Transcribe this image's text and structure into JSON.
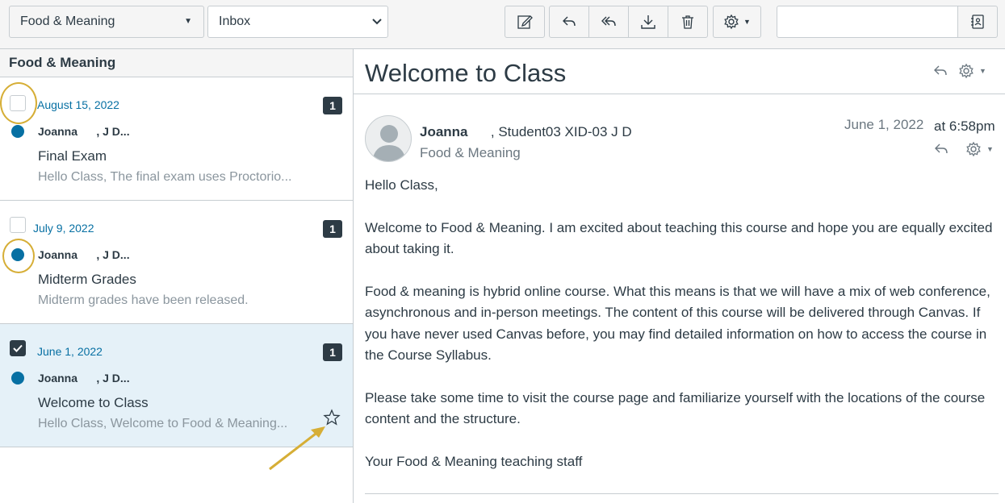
{
  "toolbar": {
    "course_filter": "Food & Meaning",
    "mailbox_filter": "Inbox",
    "search_placeholder": "",
    "icons": [
      "compose-icon",
      "reply-icon",
      "reply-all-icon",
      "archive-icon",
      "delete-icon",
      "settings-icon",
      "address-book-icon"
    ]
  },
  "list": {
    "header": "Food & Meaning",
    "messages": [
      {
        "date": "August 15, 2022",
        "count": "1",
        "author": "Joanna      , J D...",
        "subject": "Final Exam",
        "preview": "Hello Class, The final exam uses Proctorio...",
        "unread": true,
        "checked": false,
        "selected": false
      },
      {
        "date": "July 9, 2022",
        "count": "1",
        "author": "Joanna      , J D...",
        "subject": "Midterm Grades",
        "preview": "Midterm grades have been released.",
        "unread": true,
        "checked": false,
        "selected": false
      },
      {
        "date": "June 1, 2022",
        "count": "1",
        "author": "Joanna      , J D...",
        "subject": "Welcome to Class",
        "preview": "Hello Class, Welcome to Food & Meaning...",
        "unread": true,
        "checked": true,
        "selected": true,
        "star_icon": "star-outline-icon"
      }
    ]
  },
  "reader": {
    "title": "Welcome to Class",
    "sender_name": "Joanna",
    "sender_rest": "      , Student03 XID-03 J D",
    "course": "Food & Meaning",
    "date": "June 1, 2022",
    "time": "at 6:58pm",
    "body": [
      "Hello Class,",
      "Welcome to Food & Meaning. I am excited about teaching this course and hope you are equally excited about taking it.",
      "Food & meaning is hybrid online course. What this means is that we will have a mix of web conference, asynchronous and in-person meetings. The content of this course will be delivered through Canvas. If you have never used Canvas before, you may find detailed information on how to access the course in the Course Syllabus.",
      "Please take some time to visit the course page and familiarize yourself with the locations of the course content and the structure.",
      "Your Food & Meaning teaching staff"
    ]
  },
  "colors": {
    "accent": "#0770a3",
    "text": "#2d3b45",
    "muted": "#8b969e",
    "selected_bg": "#e5f1f8",
    "annotation": "#d6ae36"
  }
}
